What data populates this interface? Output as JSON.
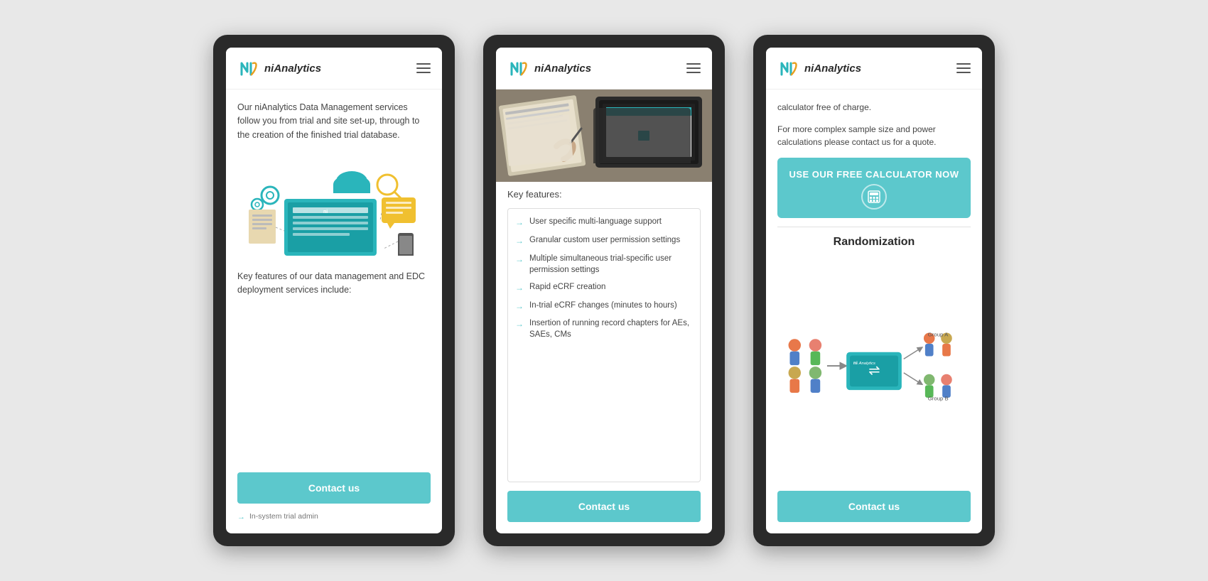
{
  "scene": {
    "background_color": "#e8e8e8"
  },
  "brand": {
    "name_bold": "ni",
    "name_italic": "Analytics"
  },
  "phone1": {
    "body_text": "Our niAnalytics Data Management services follow you from trial and site set-up, through to the creation of the finished trial database.",
    "key_features_text": "Key features of our data management and EDC deployment services include:",
    "contact_btn": "Contact us",
    "bottom_partial": "In-system trial admin"
  },
  "phone2": {
    "key_features_heading": "Key features:",
    "features": [
      "User specific multi-language support",
      "Granular custom user permission settings",
      "Multiple simultaneous trial-specific user permission settings",
      "Rapid eCRF creation",
      "In-trial eCRF changes (minutes to hours)",
      "Insertion of running record chapters for AEs, SAEs, CMs"
    ],
    "contact_btn": "Contact us"
  },
  "phone3": {
    "text1": "calculator free of charge.",
    "text2": "For more complex sample size and power calculations please contact us for a quote.",
    "calculator_btn_label": "USE OUR FREE CALCULATOR NOW",
    "calculator_icon": "🧮",
    "randomization_heading": "Randomization",
    "contact_btn": "Contact us"
  },
  "icons": {
    "hamburger": "≡",
    "arrow": "→"
  }
}
